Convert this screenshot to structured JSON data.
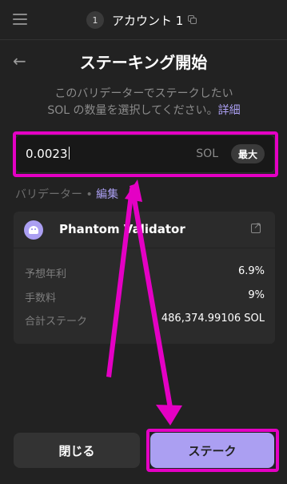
{
  "header": {
    "account_number": "1",
    "account_name": "アカウント 1"
  },
  "page": {
    "title": "ステーキング開始",
    "subtitle_line1": "このバリデーターでステークしたい",
    "subtitle_line2": "SOL の数量を選択してください。",
    "details_link": "詳細"
  },
  "amount": {
    "value": "0.0023",
    "unit": "SOL",
    "max_label": "最大"
  },
  "validator_section": {
    "label": "バリデーター • ",
    "edit_link": "編集"
  },
  "validator": {
    "name": "Phantom Validator",
    "stats": [
      {
        "label": "予想年利",
        "value": "6.9%"
      },
      {
        "label": "手数料",
        "value": "9%"
      },
      {
        "label": "合計ステーク",
        "value": "486,374.99106 SOL"
      }
    ]
  },
  "footer": {
    "close_label": "閉じる",
    "stake_label": "ステーク"
  },
  "colors": {
    "background": "#222222",
    "accent": "#ab9ff2",
    "annotation": "#e400c4"
  }
}
